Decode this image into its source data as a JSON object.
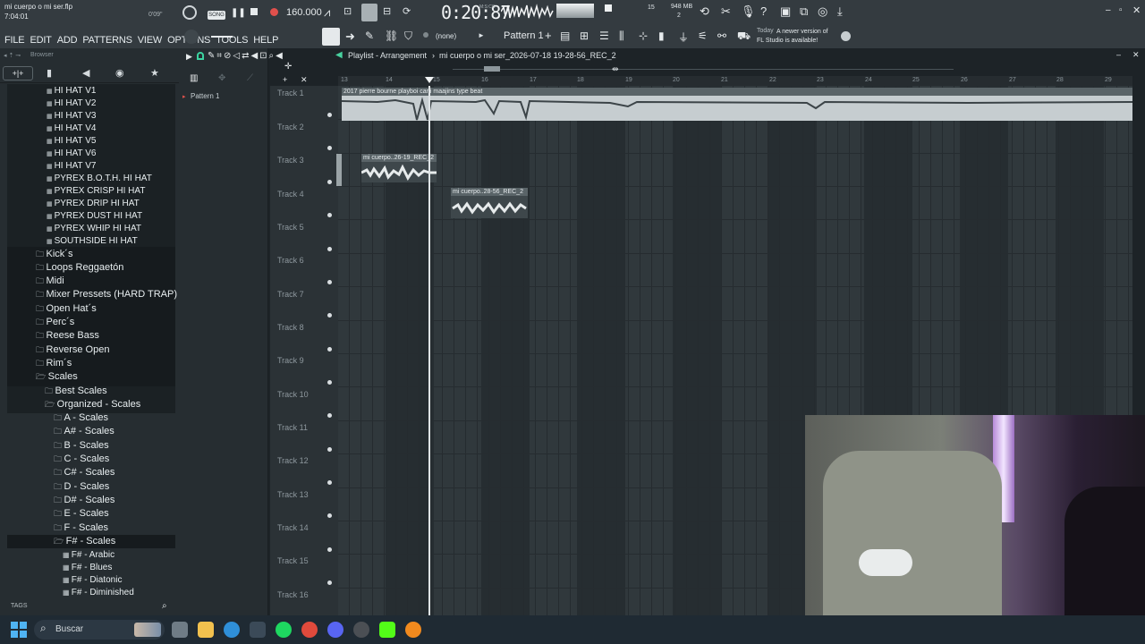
{
  "window": {
    "title": "mi cuerpo o mi ser.flp",
    "time": "7:04:01"
  },
  "transport": {
    "song_label": "SONG",
    "tempo": "160.000",
    "song_position": "0:20:87",
    "position_unit": "M:S:CS",
    "pitch": "0'09\"",
    "cpu": "15",
    "memory": "948 MB",
    "voices": "2"
  },
  "menu": [
    "FILE",
    "EDIT",
    "ADD",
    "PATTERNS",
    "VIEW",
    "OPTIONS",
    "TOOLS",
    "HELP"
  ],
  "pattern_selector": {
    "none_label": "(none)",
    "pattern_label": "Pattern 1"
  },
  "news": {
    "day": "Today",
    "message": "A newer version of FL Studio is available!"
  },
  "browser": {
    "title": "Browser",
    "tags_label": "TAGS",
    "files": [
      "HI HAT V1",
      "HI HAT V2",
      "HI HAT V3",
      "HI HAT V4",
      "HI HAT V5",
      "HI HAT V6",
      "HI HAT V7",
      "PYREX B.O.T.H. HI HAT",
      "PYREX CRISP HI HAT",
      "PYREX DRIP HI HAT",
      "PYREX DUST HI HAT",
      "PYREX WHIP HI HAT",
      "SOUTHSIDE HI HAT"
    ],
    "folders": [
      "Kick´s",
      "Loops Reggaetón",
      "Midi",
      "Mixer Pressets (HARD TRAP)",
      "Open Hat´s",
      "Perc´s",
      "Reese Bass",
      "Reverse Open",
      "Rim´s",
      "Scales"
    ],
    "scales": [
      "Best Scales",
      "Organized - Scales"
    ],
    "scale_keys": [
      "A - Scales",
      "A# - Scales",
      "B - Scales",
      "C - Scales",
      "C# - Scales",
      "D - Scales",
      "D# - Scales",
      "E - Scales",
      "F - Scales",
      "F# - Scales"
    ],
    "fsharp_items": [
      "F# - Arabic",
      "F# - Blues",
      "F# - Diatonic",
      "F# - Diminished"
    ]
  },
  "playlist": {
    "title": "Playlist - Arrangement",
    "arrangement": "mi cuerpo o mi ser_2026-07-18 19-28-56_REC_2",
    "pattern": "Pattern 1",
    "ruler": [
      "13",
      "14",
      "15",
      "16",
      "17",
      "18",
      "19",
      "20",
      "21",
      "22",
      "23",
      "24",
      "25",
      "26",
      "27",
      "28",
      "29"
    ],
    "tracks": [
      "Track 1",
      "Track 2",
      "Track 3",
      "Track 4",
      "Track 5",
      "Track 6",
      "Track 7",
      "Track 8",
      "Track 9",
      "Track 10",
      "Track 11",
      "Track 12",
      "Track 13",
      "Track 14",
      "Track 15",
      "Track 16"
    ],
    "clips": {
      "beat": "2017 pierre bourne  playboi carti  maajins type beat",
      "rec1": "mi cuerpo..26-19_REC_2",
      "rec2": "mi cuerpo..28-56_REC_2"
    }
  },
  "taskbar": {
    "search_placeholder": "Buscar"
  }
}
